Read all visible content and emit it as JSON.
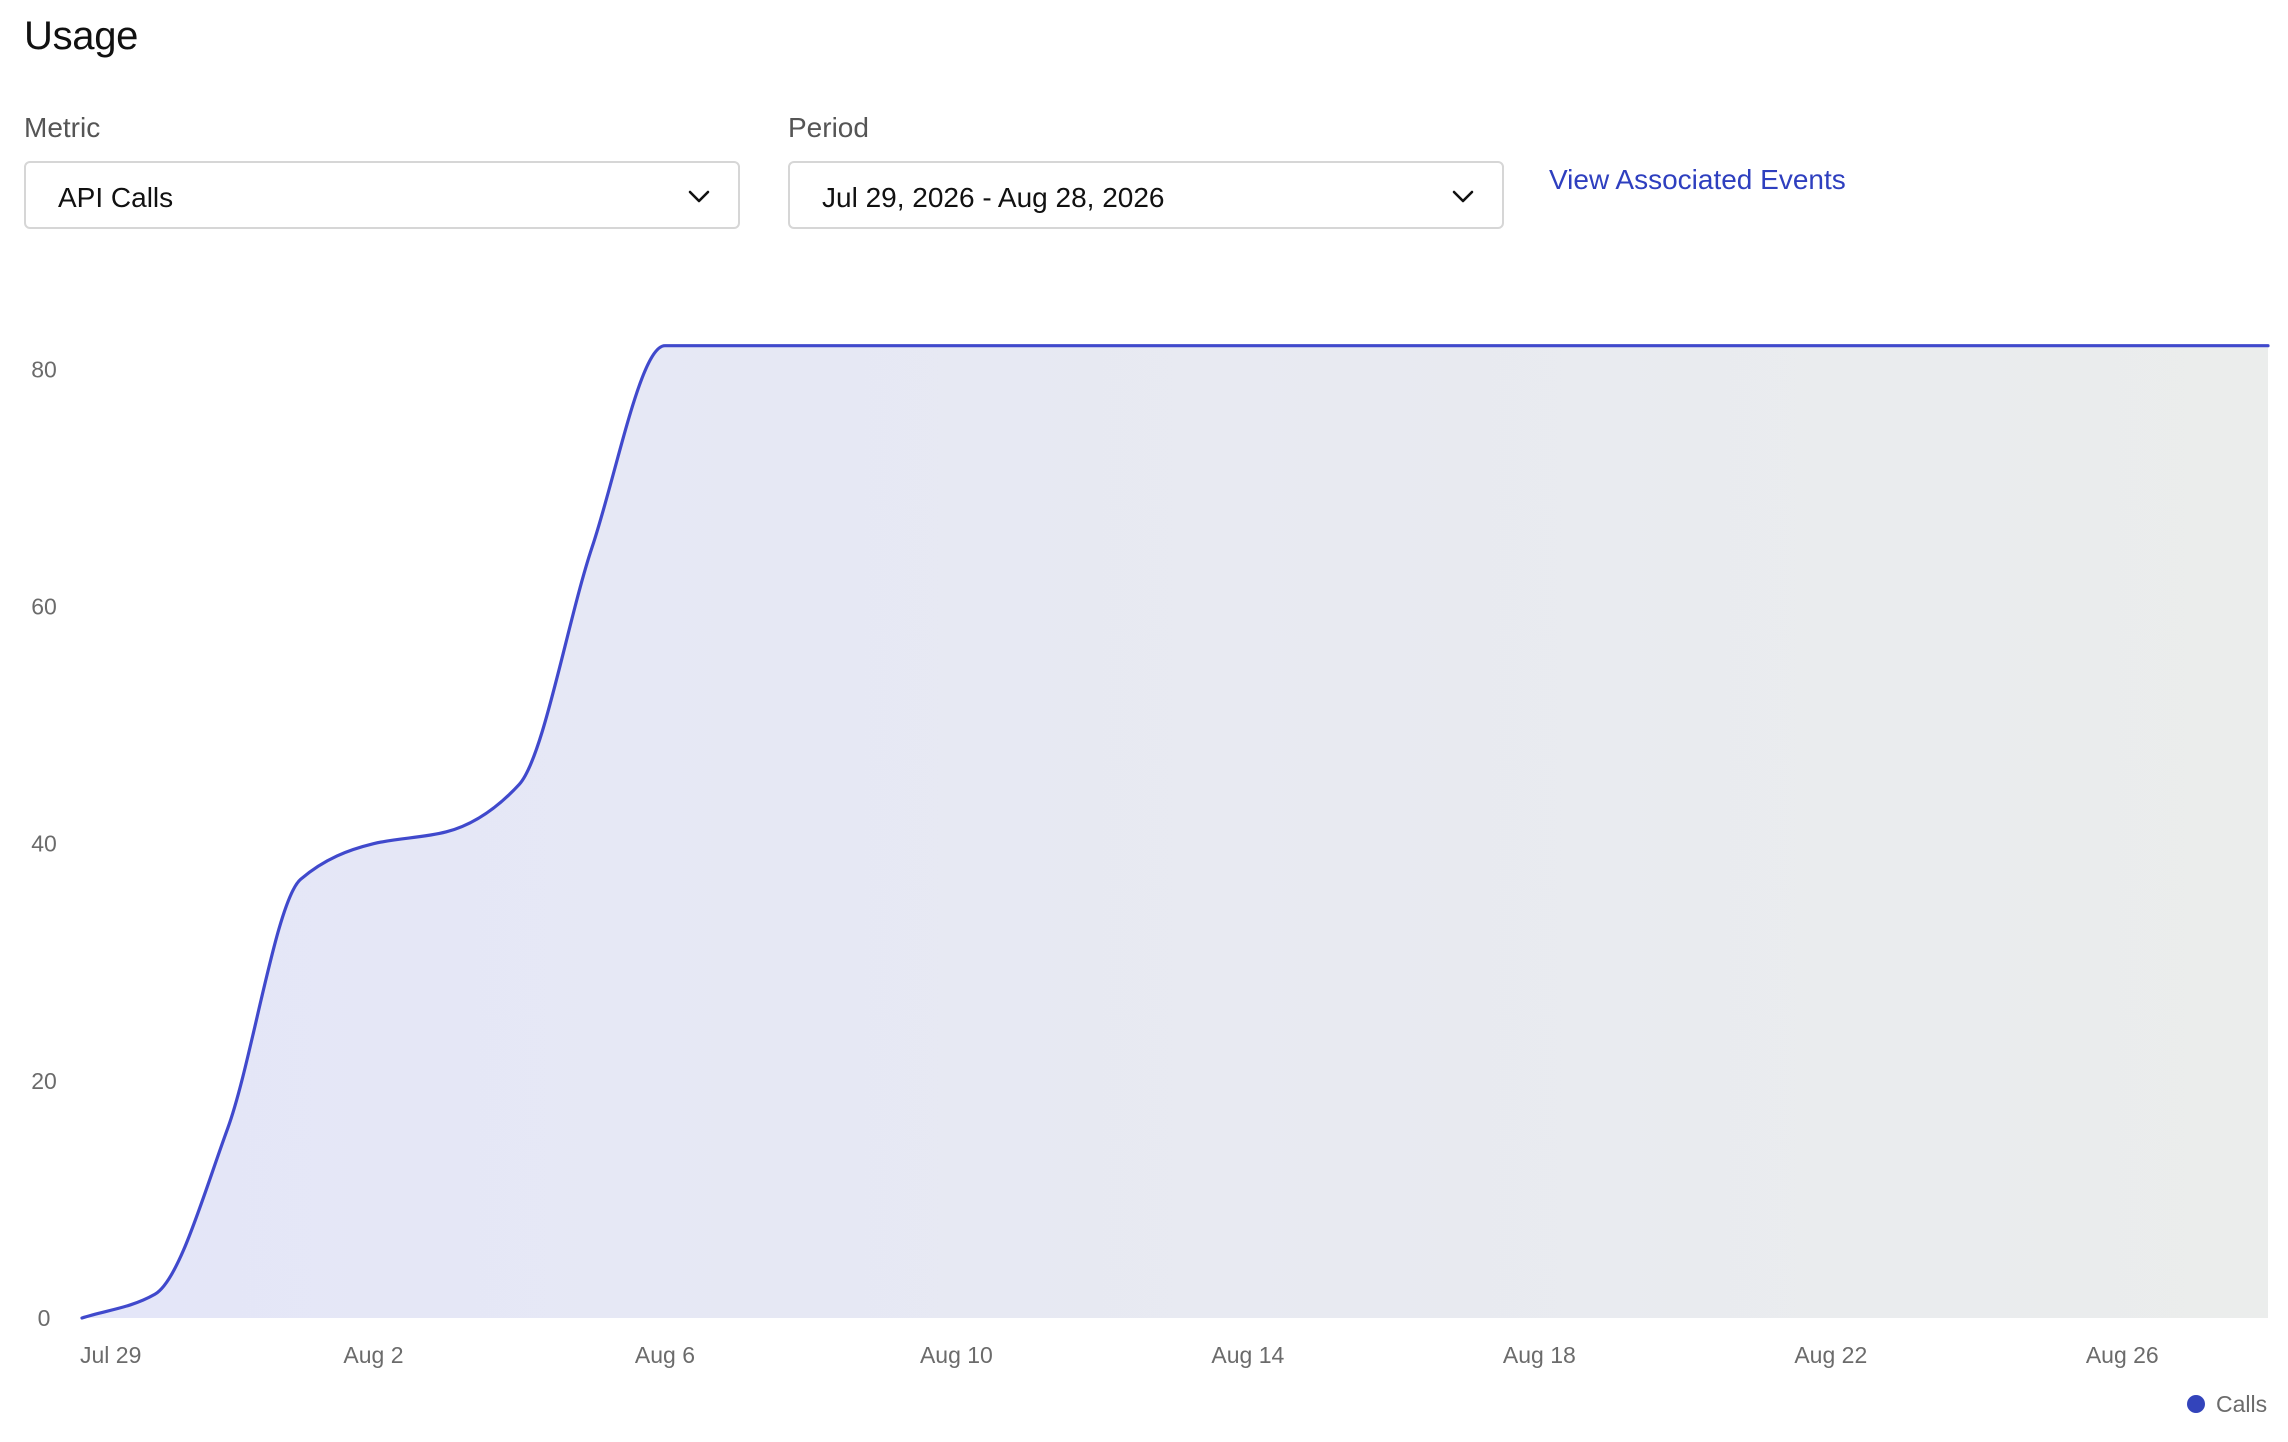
{
  "page": {
    "title": "Usage"
  },
  "filters": {
    "metric_label": "Metric",
    "metric_value": "API Calls",
    "period_label": "Period",
    "period_value": "Jul 29, 2026 - Aug 28, 2026",
    "associated_events_link": "View Associated Events"
  },
  "icons": {
    "metric_dropdown": "chevron-down-icon",
    "period_dropdown": "chevron-down-icon",
    "legend_marker": "circle-icon"
  },
  "colors": {
    "series_line": "#4049cc",
    "area_fill_start": "#e4e6f8",
    "area_fill_end": "#ebedec",
    "link": "#2e3fbf",
    "legend_dot": "#3344bb"
  },
  "chart_data": {
    "type": "area",
    "title": "",
    "xlabel": "",
    "ylabel": "",
    "x_tick_labels": [
      "Jul 29",
      "Aug 2",
      "Aug 6",
      "Aug 10",
      "Aug 14",
      "Aug 18",
      "Aug 22",
      "Aug 26"
    ],
    "y_ticks": [
      0,
      20,
      40,
      60,
      80
    ],
    "ylim": [
      0,
      84
    ],
    "xlim": [
      "2026-07-29",
      "2026-08-28"
    ],
    "grid": false,
    "legend_position": "bottom-right",
    "series": [
      {
        "name": "Calls",
        "points": [
          {
            "x": "2026-07-29",
            "y": 0
          },
          {
            "x": "2026-07-30",
            "y": 2
          },
          {
            "x": "2026-07-31",
            "y": 16
          },
          {
            "x": "2026-08-01",
            "y": 37
          },
          {
            "x": "2026-08-02",
            "y": 40
          },
          {
            "x": "2026-08-03",
            "y": 41
          },
          {
            "x": "2026-08-04",
            "y": 45
          },
          {
            "x": "2026-08-05",
            "y": 65
          },
          {
            "x": "2026-08-06",
            "y": 82
          },
          {
            "x": "2026-08-07",
            "y": 82
          },
          {
            "x": "2026-08-10",
            "y": 82
          },
          {
            "x": "2026-08-14",
            "y": 82
          },
          {
            "x": "2026-08-18",
            "y": 82
          },
          {
            "x": "2026-08-22",
            "y": 82
          },
          {
            "x": "2026-08-26",
            "y": 82
          },
          {
            "x": "2026-08-28",
            "y": 82
          }
        ]
      }
    ]
  }
}
